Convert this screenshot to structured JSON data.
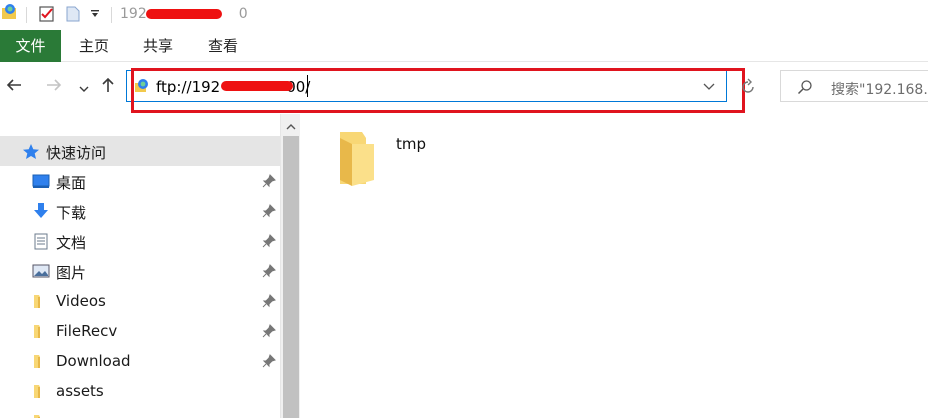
{
  "window": {
    "title_visible": "192",
    "title_tail": "0"
  },
  "ribbon": {
    "tabs": [
      "文件",
      "主页",
      "共享",
      "查看"
    ]
  },
  "address_bar": {
    "prefix": "ftp://192",
    "suffix": "00/"
  },
  "search": {
    "placeholder": "搜索\"192.168."
  },
  "sidebar": {
    "quick_access_label": "快速访问",
    "items": [
      {
        "label": "桌面",
        "icon": "desktop-icon",
        "pinned": true
      },
      {
        "label": "下载",
        "icon": "download-arrow-icon",
        "pinned": true
      },
      {
        "label": "文档",
        "icon": "document-icon",
        "pinned": true
      },
      {
        "label": "图片",
        "icon": "picture-icon",
        "pinned": true
      },
      {
        "label": "Videos",
        "icon": "folder-icon",
        "pinned": true
      },
      {
        "label": "FileRecv",
        "icon": "folder-icon",
        "pinned": true
      },
      {
        "label": "Download",
        "icon": "folder-icon",
        "pinned": true
      },
      {
        "label": "assets",
        "icon": "folder-icon",
        "pinned": false
      }
    ]
  },
  "content": {
    "files": [
      {
        "name": "tmp",
        "type": "folder"
      }
    ]
  },
  "colors": {
    "file_tab": "#2a7a37",
    "address_border": "#0078d7",
    "annotation_red": "#e0141e",
    "folder_yellow": "#f8d775"
  }
}
